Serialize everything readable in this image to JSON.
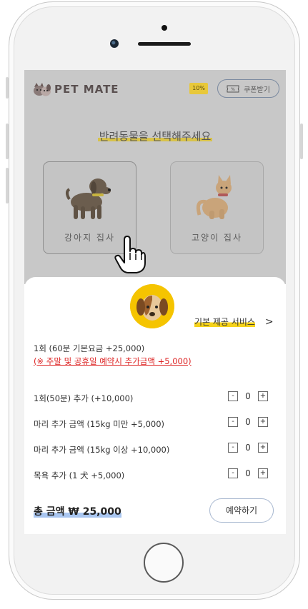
{
  "header": {
    "brand": "PET MATE",
    "badge": "10%",
    "coupon_label": "쿠폰받기"
  },
  "select": {
    "title": "반려동물을 선택해주세요",
    "dog_label": "강아지 집사",
    "cat_label": "고양이 집사"
  },
  "sheet": {
    "service_link": "기본 제공 서비스",
    "chevron": ">",
    "base_price": "1회 (60분 기본요금 +25,000)",
    "note": "(※ 주말 및 공휴일 예약시 추가금액  +5,000)",
    "options": [
      {
        "label": "1회(50분) 추가 (+10,000)",
        "value": "0"
      },
      {
        "label": "마리 추가 금액 (15kg 미만 +5,000)",
        "value": "0"
      },
      {
        "label": "마리 추가 금액 (15kg 이상 +10,000)",
        "value": "0"
      },
      {
        "label": "목욕 추가 (1 犬 +5,000)",
        "value": "0"
      }
    ],
    "minus": "-",
    "plus": "+",
    "total": "총 금액 ₩ 25,000",
    "reserve_label": "예약하기"
  },
  "colors": {
    "accent_yellow": "#f5c400",
    "highlight_blue": "#a9c6f0",
    "note_red": "#d22222"
  }
}
